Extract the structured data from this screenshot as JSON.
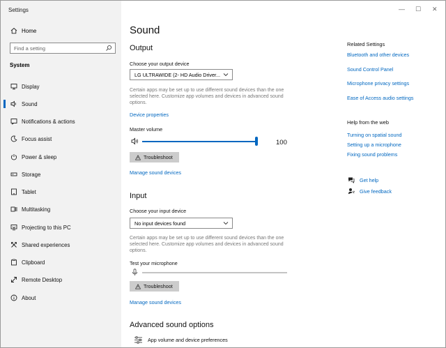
{
  "window": {
    "title": "Settings",
    "minimize": "—",
    "maximize": "☐",
    "close": "✕"
  },
  "sidebar": {
    "home_label": "Home",
    "search_placeholder": "Find a setting",
    "section_label": "System",
    "items": [
      {
        "label": "Display",
        "icon": "display-icon"
      },
      {
        "label": "Sound",
        "icon": "speaker-icon",
        "active": true
      },
      {
        "label": "Notifications & actions",
        "icon": "notification-icon"
      },
      {
        "label": "Focus assist",
        "icon": "moon-icon"
      },
      {
        "label": "Power & sleep",
        "icon": "power-icon"
      },
      {
        "label": "Storage",
        "icon": "storage-icon"
      },
      {
        "label": "Tablet",
        "icon": "tablet-icon"
      },
      {
        "label": "Multitasking",
        "icon": "multitasking-icon"
      },
      {
        "label": "Projecting to this PC",
        "icon": "projecting-icon"
      },
      {
        "label": "Shared experiences",
        "icon": "shared-icon"
      },
      {
        "label": "Clipboard",
        "icon": "clipboard-icon"
      },
      {
        "label": "Remote Desktop",
        "icon": "remote-icon"
      },
      {
        "label": "About",
        "icon": "info-icon"
      }
    ]
  },
  "main": {
    "title": "Sound",
    "output": {
      "heading": "Output",
      "device_label": "Choose your output device",
      "device_value": "LG ULTRAWIDE (2- HD Audio Driver...",
      "note": "Certain apps may be set up to use different sound devices than the one selected here. Customize app volumes and devices in advanced sound options.",
      "device_properties": "Device properties",
      "master_volume_label": "Master volume",
      "master_volume_value": "100",
      "troubleshoot": "Troubleshoot",
      "manage": "Manage sound devices"
    },
    "input": {
      "heading": "Input",
      "device_label": "Choose your input device",
      "device_value": "No input devices found",
      "note": "Certain apps may be set up to use different sound devices than the one selected here. Customize app volumes and devices in advanced sound options.",
      "test_label": "Test your microphone",
      "troubleshoot": "Troubleshoot",
      "manage": "Manage sound devices"
    },
    "advanced": {
      "heading": "Advanced sound options",
      "app_volume": "App volume and device preferences"
    }
  },
  "related": {
    "heading": "Related Settings",
    "links": [
      "Bluetooth and other devices",
      "Sound Control Panel",
      "Microphone privacy settings",
      "Ease of Access audio settings"
    ]
  },
  "help": {
    "heading": "Help from the web",
    "links": [
      "Turning on spatial sound",
      "Setting up a microphone",
      "Fixing sound problems"
    ],
    "get_help": "Get help",
    "give_feedback": "Give feedback"
  },
  "colors": {
    "accent": "#0067c0",
    "sidebar_bg": "#f2f2f2",
    "button_bg": "#cccccc",
    "note_text": "#777777"
  }
}
